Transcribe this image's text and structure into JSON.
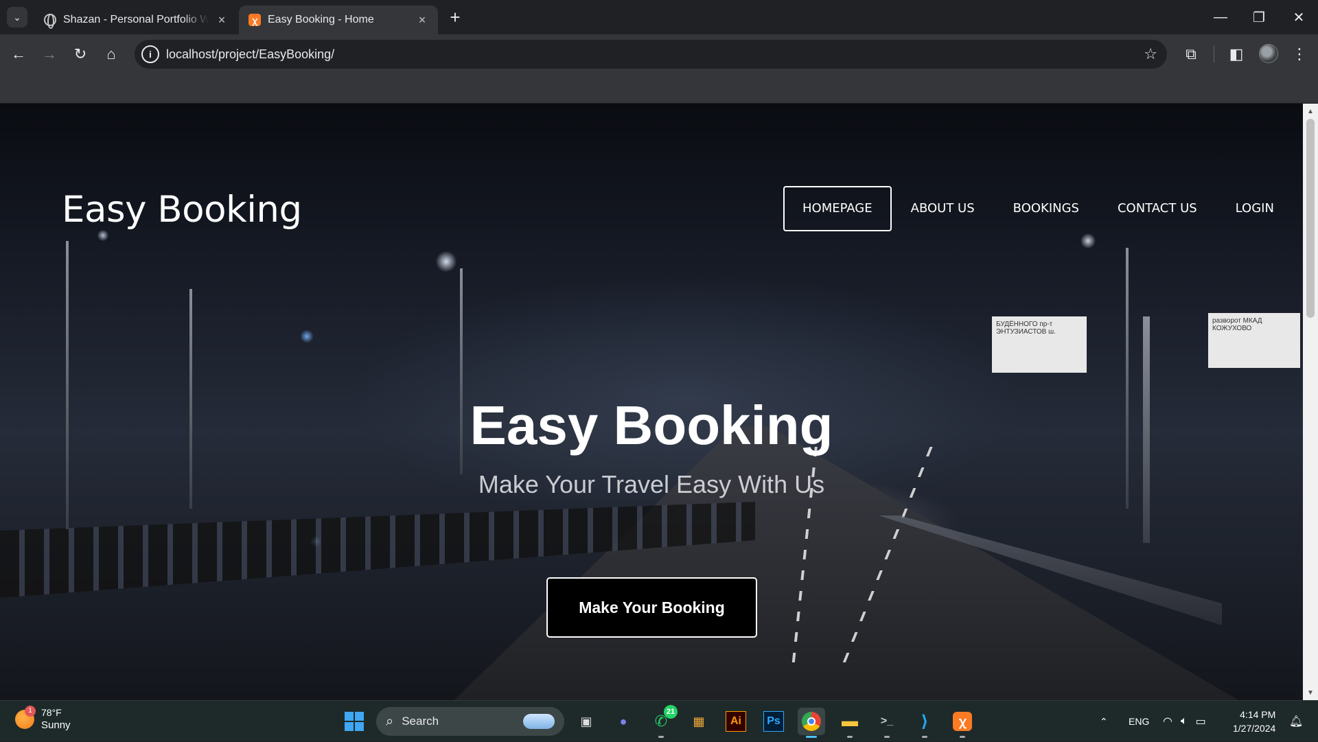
{
  "browser": {
    "tabs": [
      {
        "title": "Shazan - Personal Portfolio Website",
        "active": false,
        "favicon": "globe-icon"
      },
      {
        "title": "Easy Booking - Home",
        "active": true,
        "favicon": "xampp-icon"
      }
    ],
    "url": "localhost/project/EasyBooking/"
  },
  "site": {
    "logo": "Easy Booking",
    "nav": [
      {
        "label": "HOMEPAGE",
        "active": true
      },
      {
        "label": "ABOUT US",
        "active": false
      },
      {
        "label": "BOOKINGS",
        "active": false
      },
      {
        "label": "CONTACT US",
        "active": false
      },
      {
        "label": "LOGIN",
        "active": false
      }
    ],
    "hero": {
      "title": "Easy Booking",
      "subtitle": "Make Your Travel Easy With Us",
      "cta": "Make Your Booking"
    },
    "background_signs": [
      "БУДЁННОГО пр-т ЭНТУЗИАСТОВ ш.",
      "разворот МКАД КОЖУХОВО"
    ]
  },
  "taskbar": {
    "weather": {
      "temp": "78°F",
      "condition": "Sunny",
      "badge": "1"
    },
    "search_placeholder": "Search",
    "apps": [
      {
        "name": "task-view-icon"
      },
      {
        "name": "teams-meet-icon"
      },
      {
        "name": "whatsapp-icon",
        "badge": "21"
      },
      {
        "name": "microsoft-store-icon"
      },
      {
        "name": "illustrator-icon",
        "label": "Ai"
      },
      {
        "name": "photoshop-icon",
        "label": "Ps"
      },
      {
        "name": "chrome-icon"
      },
      {
        "name": "file-explorer-icon"
      },
      {
        "name": "terminal-icon"
      },
      {
        "name": "vscode-icon"
      },
      {
        "name": "xampp-icon"
      }
    ],
    "tray": {
      "language": "ENG",
      "time": "4:14 PM",
      "date": "1/27/2024"
    }
  },
  "colors": {
    "chrome_dark": "#202124",
    "chrome_toolbar": "#35363a",
    "taskbar": "#1e2a2a",
    "accent_blue": "#4cc2ff",
    "xampp_orange": "#fb7a24"
  }
}
